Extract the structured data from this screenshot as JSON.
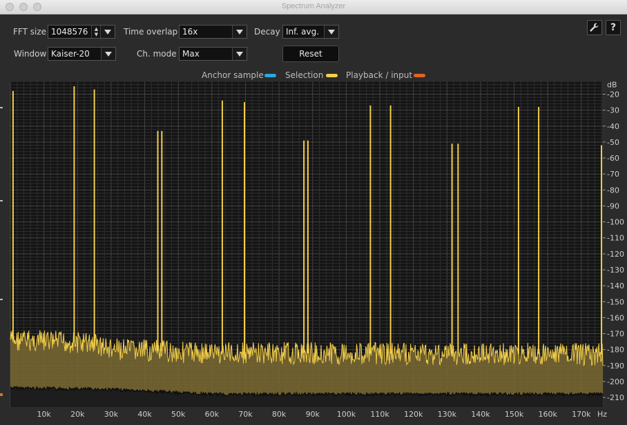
{
  "window": {
    "title": "Spectrum Analyzer"
  },
  "controls": {
    "fft_size": {
      "label": "FFT size",
      "value": "1048576"
    },
    "time_overlap": {
      "label": "Time overlap",
      "value": "16x"
    },
    "decay": {
      "label": "Decay",
      "value": "Inf. avg."
    },
    "window": {
      "label": "Window",
      "value": "Kaiser-20"
    },
    "ch_mode": {
      "label": "Ch. mode",
      "value": "Max"
    },
    "reset_label": "Reset",
    "settings_icon": "wrench-icon",
    "help_glyph": "?"
  },
  "legend": [
    {
      "label": "Anchor sample",
      "color": "#2aa7e6"
    },
    {
      "label": "Selection",
      "color": "#f4cf4a"
    },
    {
      "label": "Playback / input",
      "color": "#e2641f"
    }
  ],
  "chart_data": {
    "type": "line",
    "x_unit": "Hz",
    "y_unit": "dB",
    "x_ticks": [
      "10k",
      "20k",
      "30k",
      "40k",
      "50k",
      "60k",
      "70k",
      "80k",
      "90k",
      "100k",
      "110k",
      "120k",
      "130k",
      "140k",
      "150k",
      "160k",
      "170k"
    ],
    "y_ticks": [
      "20",
      "30",
      "40",
      "50",
      "60",
      "70",
      "80",
      "90",
      "100",
      "110",
      "120",
      "130",
      "140",
      "150",
      "160",
      "170",
      "180",
      "190",
      "200",
      "210"
    ],
    "xlim": [
      0,
      176400
    ],
    "ylim": [
      216,
      12
    ],
    "grid": true,
    "series": [
      {
        "color": "#f4cf4a",
        "noise_floor_db": [
          {
            "x": 0,
            "y": 174
          },
          {
            "x": 25000,
            "y": 176
          },
          {
            "x": 30000,
            "y": 180
          },
          {
            "x": 60000,
            "y": 182
          },
          {
            "x": 176400,
            "y": 183
          }
        ],
        "lower_floor_db": [
          {
            "x": 0,
            "y": 204
          },
          {
            "x": 30000,
            "y": 205
          },
          {
            "x": 60000,
            "y": 208
          },
          {
            "x": 176400,
            "y": 208
          }
        ],
        "peaks": [
          {
            "x": 800,
            "y": 18
          },
          {
            "x": 19000,
            "y": 15
          },
          {
            "x": 25000,
            "y": 17
          },
          {
            "x": 43900,
            "y": 43
          },
          {
            "x": 45100,
            "y": 43
          },
          {
            "x": 63100,
            "y": 24
          },
          {
            "x": 69700,
            "y": 25
          },
          {
            "x": 87400,
            "y": 49
          },
          {
            "x": 88600,
            "y": 49
          },
          {
            "x": 107200,
            "y": 27
          },
          {
            "x": 113200,
            "y": 27
          },
          {
            "x": 131500,
            "y": 51
          },
          {
            "x": 133300,
            "y": 51
          },
          {
            "x": 151300,
            "y": 28
          },
          {
            "x": 157300,
            "y": 28
          },
          {
            "x": 176000,
            "y": 52
          }
        ]
      }
    ]
  }
}
